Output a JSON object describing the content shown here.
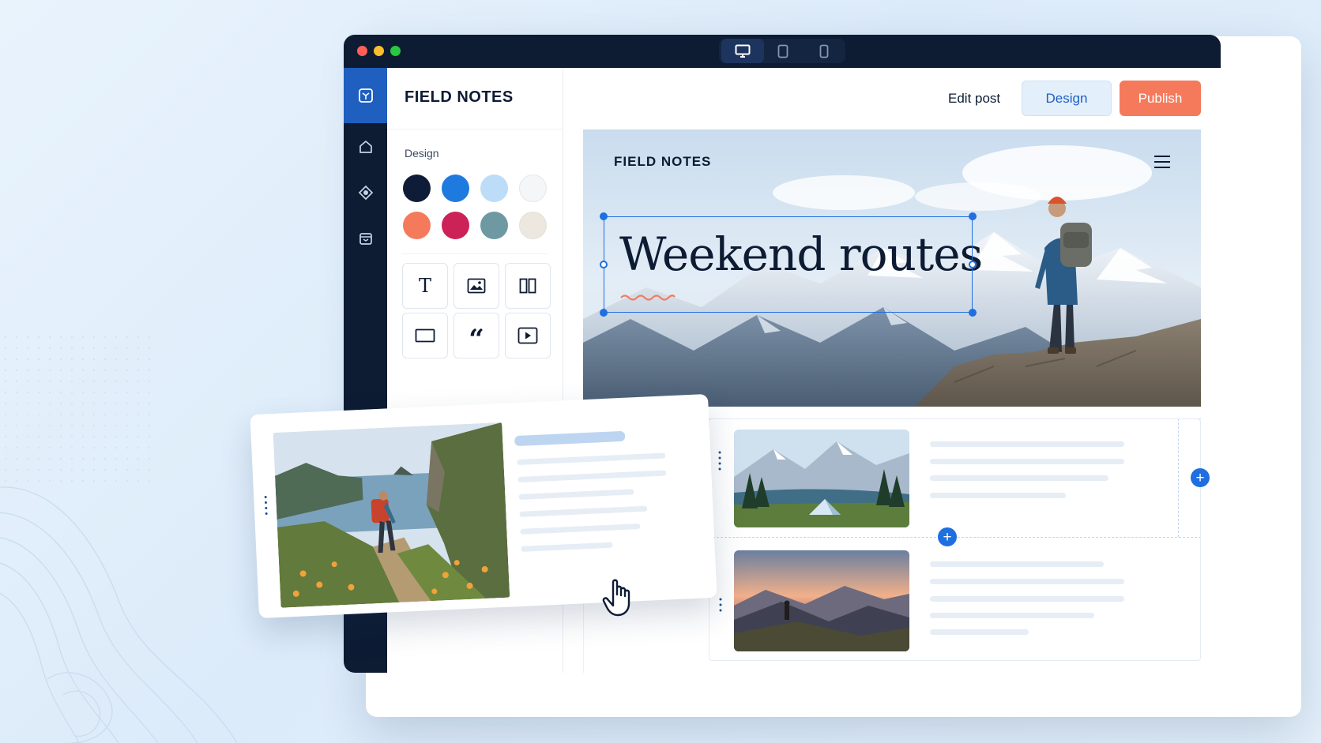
{
  "app": {
    "brand": "FIELD NOTES",
    "colors": {
      "navy": "#0d1b33",
      "accent": "#1f6fe0",
      "publish": "#f57a5c"
    }
  },
  "titlebar": {
    "traffic_lights": [
      "#ff5f57",
      "#febc2e",
      "#28c840"
    ],
    "devices": [
      {
        "name": "desktop-icon",
        "active": true
      },
      {
        "name": "tablet-icon",
        "active": false
      },
      {
        "name": "mobile-icon",
        "active": false
      }
    ]
  },
  "rail": {
    "items": [
      {
        "icon": "brand-logo-icon",
        "active": true
      },
      {
        "icon": "home-icon",
        "active": false
      },
      {
        "icon": "theme-icon",
        "active": false
      },
      {
        "icon": "archive-icon",
        "active": false
      }
    ]
  },
  "panel": {
    "title": "FIELD NOTES",
    "section_label": "Design",
    "swatches": [
      "#0f1c38",
      "#1f7ae0",
      "#bcdcf8",
      "#f4f6f8",
      "#f57a5c",
      "#cc2257",
      "#6e99a3",
      "#ece8e0"
    ],
    "tools": [
      "text-tool-icon",
      "image-tool-icon",
      "columns-tool-icon",
      "container-tool-icon",
      "quote-tool-icon",
      "video-tool-icon"
    ]
  },
  "topbar": {
    "edit_label": "Edit post",
    "design_label": "Design",
    "publish_label": "Publish"
  },
  "preview": {
    "brand": "FIELD NOTES",
    "hero_title": "Weekend routes"
  }
}
